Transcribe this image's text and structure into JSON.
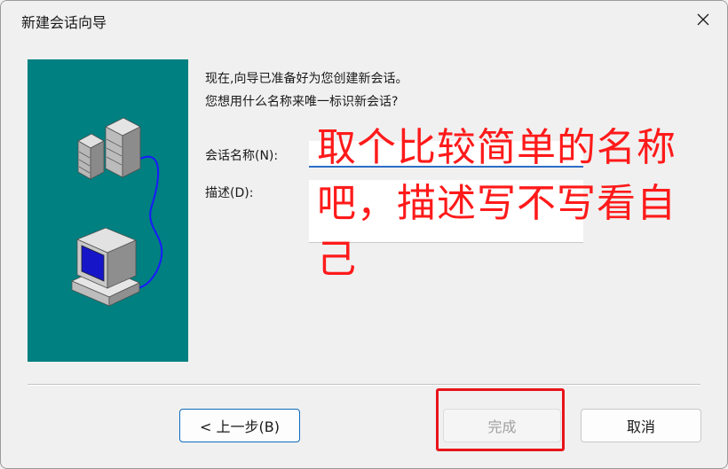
{
  "window": {
    "title": "新建会话向导"
  },
  "intro": {
    "line1": "现在,向导已准备好为您创建新会话。",
    "line2": "您想用什么名称来唯一标识新会话?"
  },
  "form": {
    "name_label": "会话名称(N):",
    "name_value": "",
    "desc_label": "描述(D):",
    "desc_value": ""
  },
  "annotation": {
    "line1": "取个比较简单的名称",
    "line2": "吧，描述写不写看自",
    "line3": "己",
    "color": "#ff1a1a"
  },
  "buttons": {
    "back": "< 上一步(B)",
    "finish": "完成",
    "cancel": "取消"
  },
  "icons": {
    "close": "close-icon",
    "servers": "server-stack-icon",
    "computer": "desktop-computer-icon"
  },
  "colors": {
    "panel": "#008080",
    "focus": "#2a6ec6",
    "highlight_box": "#e8141a"
  }
}
